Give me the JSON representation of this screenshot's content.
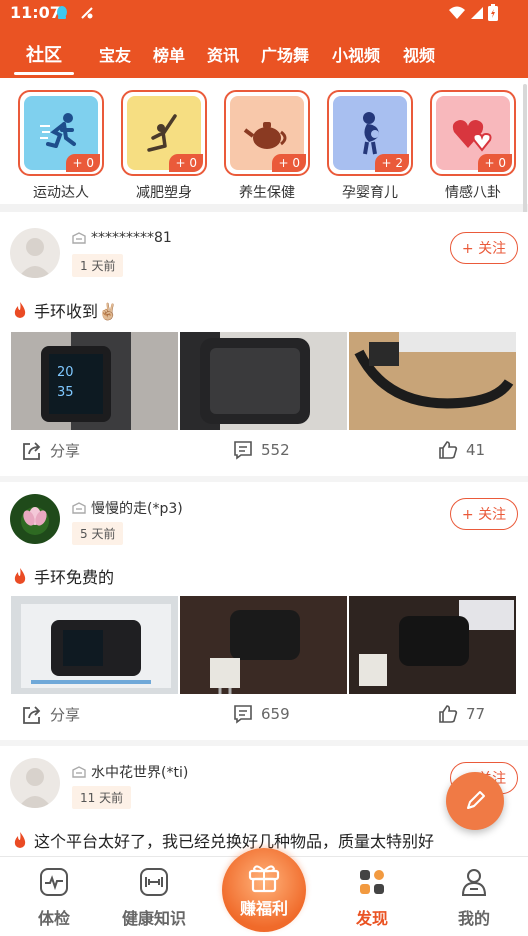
{
  "status_bar": {
    "time": "11:07"
  },
  "tabs": [
    {
      "label": "社区",
      "active": true
    },
    {
      "label": "宝友"
    },
    {
      "label": "榜单"
    },
    {
      "label": "资讯"
    },
    {
      "label": "广场舞"
    },
    {
      "label": "小视频"
    },
    {
      "label": "视频"
    }
  ],
  "categories": [
    {
      "label": "运动达人",
      "badge": "+ 0",
      "icon": "running-icon",
      "bg": "#7fd0ee"
    },
    {
      "label": "减肥塑身",
      "badge": "+ 0",
      "icon": "yoga-icon",
      "bg": "#f6de82"
    },
    {
      "label": "养生保健",
      "badge": "+ 0",
      "icon": "teapot-icon",
      "bg": "#f8c8aa"
    },
    {
      "label": "孕婴育儿",
      "badge": "+ 2",
      "icon": "pregnant-icon",
      "bg": "#a8bff0"
    },
    {
      "label": "情感八卦",
      "badge": "+ 0",
      "icon": "hearts-icon",
      "bg": "#f8b8bc"
    }
  ],
  "posts": [
    {
      "user": "*********81",
      "time": "1 天前",
      "follow": "+ 关注",
      "text": "手环收到✌🏼",
      "share": "分享",
      "comments": "552",
      "likes": "41"
    },
    {
      "user": "慢慢的走(*p3)",
      "time": "5 天前",
      "follow": "+ 关注",
      "text": "手环免费的",
      "share": "分享",
      "comments": "659",
      "likes": "77"
    },
    {
      "user": "水中花世界(*ti)",
      "time": "11 天前",
      "follow": "+ 关注",
      "text": "这个平台太好了，我已经兑换好几种物品，质量太特别好"
    }
  ],
  "bottom_nav": [
    {
      "label": "体检",
      "icon": "checkup-icon"
    },
    {
      "label": "健康知识",
      "icon": "dumbbell-icon"
    },
    {
      "label": "赚福利",
      "icon": "gift-icon",
      "center": true
    },
    {
      "label": "发现",
      "icon": "discover-icon",
      "active": true
    },
    {
      "label": "我的",
      "icon": "profile-icon"
    }
  ],
  "colors": {
    "brand": "#ea5323",
    "accent": "#ea5a3a",
    "fab": "#f07a45"
  }
}
